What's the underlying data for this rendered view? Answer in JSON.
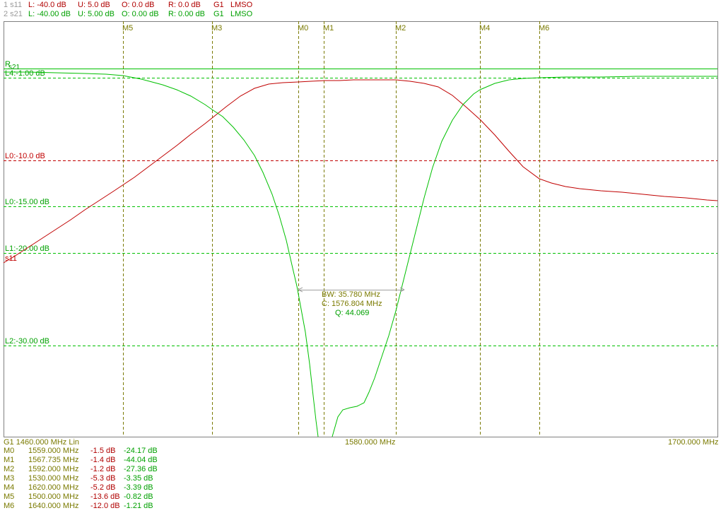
{
  "header": {
    "trace1": {
      "id": "1 s11",
      "L": "L: -40.0 dB",
      "U": "U: 5.0 dB",
      "O": "O: 0.0 dB",
      "R": "R: 0.0 dB",
      "G": "G1",
      "mode": "LMSO"
    },
    "trace2": {
      "id": "2 s21",
      "L": "L: -40.00 dB",
      "U": "U: 5.00 dB",
      "O": "O: 0.00 dB",
      "R": "R: 0.00 dB",
      "G": "G1",
      "mode": "LMSO"
    }
  },
  "plot": {
    "ref_labels": {
      "r": "R",
      "s21": "s21",
      "l4": "L4:-1.00 dB",
      "l0a": "L0:-10.0 dB",
      "l0b": "L0:-15.00 dB",
      "l1": "L1:-20.00 dB",
      "l2": "L2:-30.00 dB",
      "s11": "s11"
    },
    "markers": [
      "M5",
      "M3",
      "M0",
      "M1",
      "M2",
      "M4",
      "M6"
    ],
    "bw": {
      "bw": "BW:  35.780 MHz",
      "c": "C: 1576.804 MHz",
      "q": "Q:  44.069"
    }
  },
  "footer": {
    "start": "G1     1460.000 MHz  Lin",
    "center": "1580.000 MHz",
    "stop": "1700.000 MHz"
  },
  "marker_table": [
    {
      "name": "M0",
      "freq": "1559.000 MHz",
      "s11": "-1.5 dB",
      "s21": "-24.17 dB"
    },
    {
      "name": "M1",
      "freq": "1567.735 MHz",
      "s11": "-1.4 dB",
      "s21": "-44.04 dB"
    },
    {
      "name": "M2",
      "freq": "1592.000 MHz",
      "s11": "-1.2 dB",
      "s21": "-27.36 dB"
    },
    {
      "name": "M3",
      "freq": "1530.000 MHz",
      "s11": "-5.3 dB",
      "s21": "-3.35 dB"
    },
    {
      "name": "M4",
      "freq": "1620.000 MHz",
      "s11": "-5.2 dB",
      "s21": "-3.39 dB"
    },
    {
      "name": "M5",
      "freq": "1500.000 MHz",
      "s11": "-13.6 dB",
      "s21": "-0.82 dB"
    },
    {
      "name": "M6",
      "freq": "1640.000 MHz",
      "s11": "-12.0 dB",
      "s21": "-1.21 dB"
    }
  ],
  "colors": {
    "s11": "#c00000",
    "s21": "#00c000",
    "marker": "#7a7a00",
    "grid": "#808080"
  }
}
